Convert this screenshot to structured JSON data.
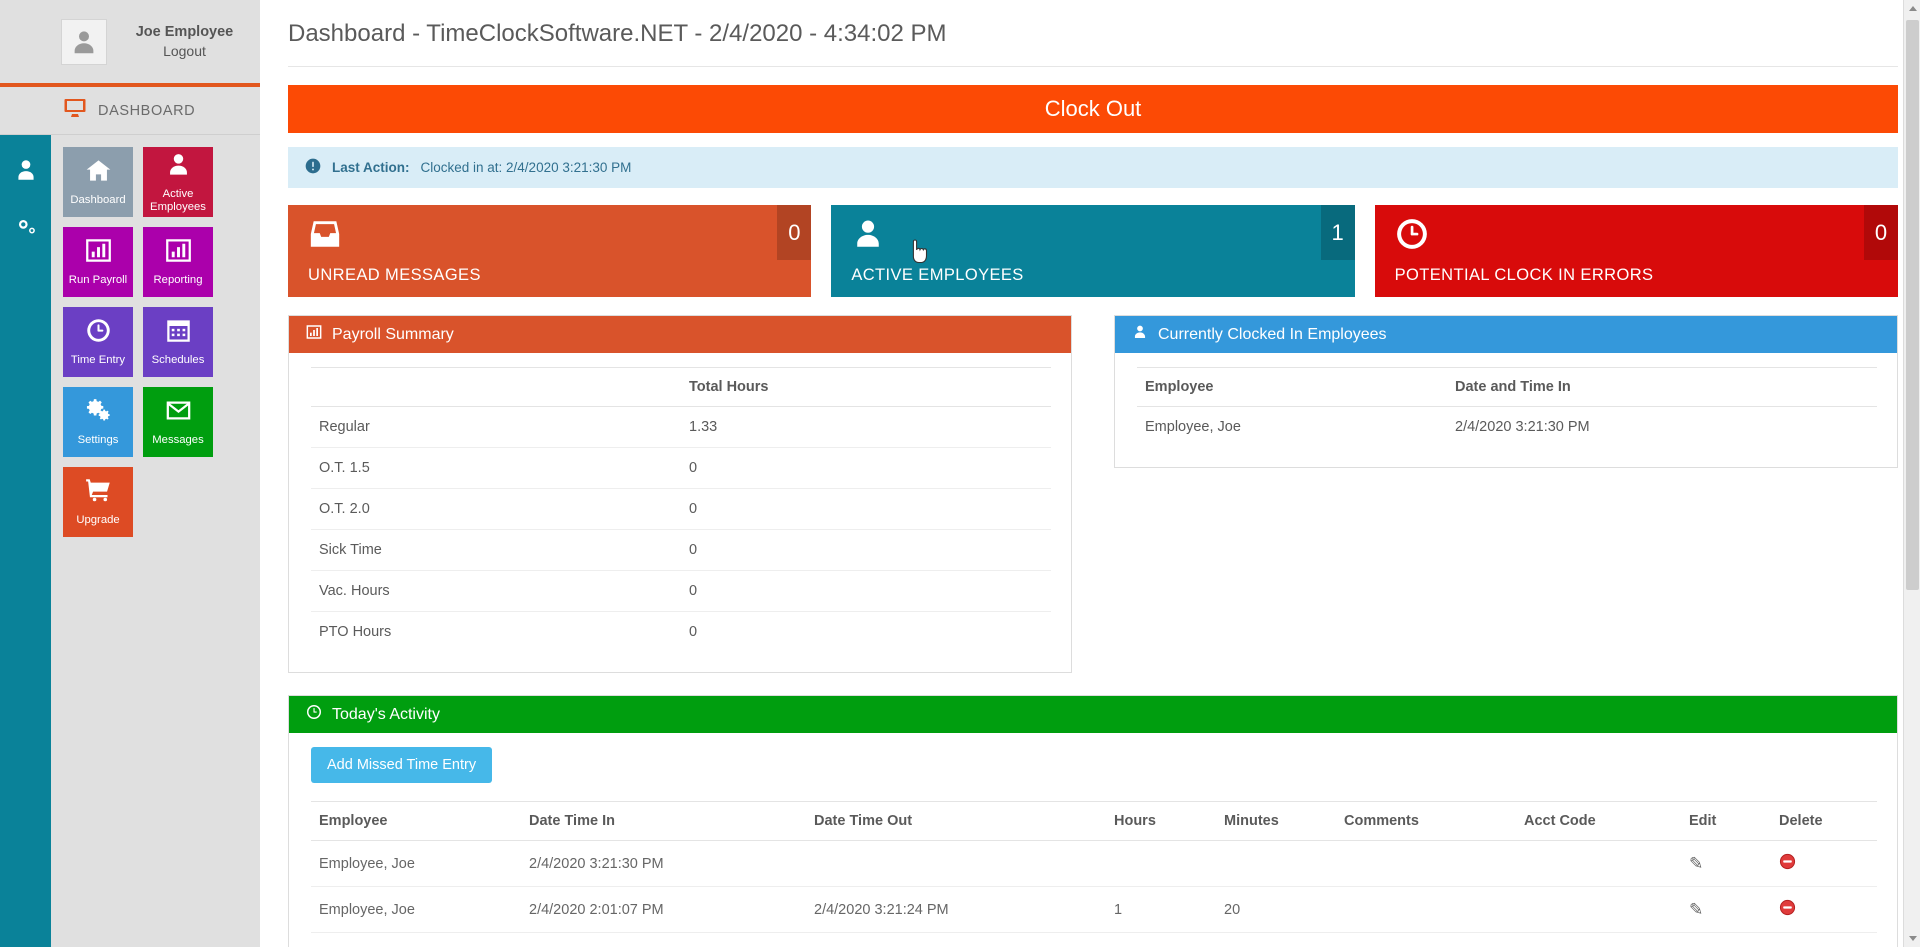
{
  "user": {
    "name": "Joe Employee",
    "logout": "Logout"
  },
  "sidebar": {
    "section_title": "DASHBOARD",
    "rail_icons": [
      "monitor-icon",
      "user-icon",
      "gears-icon"
    ],
    "tiles": [
      {
        "label": "Dashboard",
        "icon": "home-icon",
        "color": "#8c9ead"
      },
      {
        "label": "Active Employees",
        "icon": "user-icon",
        "color": "#c2163f"
      },
      {
        "label": "Run Payroll",
        "icon": "chart-bar-icon",
        "color": "#ab00ab"
      },
      {
        "label": "Reporting",
        "icon": "chart-bar-icon",
        "color": "#ab00ab"
      },
      {
        "label": "Time Entry",
        "icon": "clock-icon",
        "color": "#6b3fc4"
      },
      {
        "label": "Schedules",
        "icon": "calendar-icon",
        "color": "#6b3fc4"
      },
      {
        "label": "Settings",
        "icon": "gears-icon",
        "color": "#3498db"
      },
      {
        "label": "Messages",
        "icon": "envelope-icon",
        "color": "#009e0f"
      },
      {
        "label": "Upgrade",
        "icon": "cart-icon",
        "color": "#dd4b24"
      }
    ]
  },
  "header": {
    "title": "Dashboard - TimeClockSoftware.NET - 2/4/2020 - 4:34:02 PM"
  },
  "clock_button": {
    "label": "Clock Out",
    "color": "#fc4a05"
  },
  "alert": {
    "icon": "exclamation-circle-icon",
    "label": "Last Action:",
    "text": "Clocked in at: 2/4/2020 3:21:30 PM"
  },
  "stats": [
    {
      "label": "UNREAD MESSAGES",
      "count": "0",
      "icon": "inbox-icon",
      "color": "#d9532b"
    },
    {
      "label": "ACTIVE EMPLOYEES",
      "count": "1",
      "icon": "user-icon",
      "color": "#0a8299"
    },
    {
      "label": "POTENTIAL CLOCK IN ERRORS",
      "count": "0",
      "icon": "clock-icon",
      "color": "#d80b0b"
    }
  ],
  "payroll_summary": {
    "title": "Payroll Summary",
    "icon": "chart-bar-icon",
    "color": "#d9532b",
    "columns": [
      "",
      "Total Hours"
    ],
    "rows": [
      {
        "label": "Regular",
        "value": "1.33"
      },
      {
        "label": "O.T. 1.5",
        "value": "0"
      },
      {
        "label": "O.T. 2.0",
        "value": "0"
      },
      {
        "label": "Sick Time",
        "value": "0"
      },
      {
        "label": "Vac. Hours",
        "value": "0"
      },
      {
        "label": "PTO Hours",
        "value": "0"
      }
    ]
  },
  "clocked_in": {
    "title": "Currently Clocked In Employees",
    "icon": "user-icon",
    "color": "#3498db",
    "columns": [
      "Employee",
      "Date and Time In"
    ],
    "rows": [
      {
        "employee": "Employee, Joe",
        "datetime_in": "2/4/2020 3:21:30 PM"
      }
    ]
  },
  "activity": {
    "title": "Today's Activity",
    "icon": "clock-icon",
    "color": "#009e0f",
    "add_button": "Add Missed Time Entry",
    "columns": [
      "Employee",
      "Date Time In",
      "Date Time Out",
      "Hours",
      "Minutes",
      "Comments",
      "Acct Code",
      "Edit",
      "Delete"
    ],
    "rows": [
      {
        "employee": "Employee, Joe",
        "date_time_in": "2/4/2020 3:21:30 PM",
        "date_time_out": "",
        "hours": "",
        "minutes": "",
        "comments": "",
        "acct_code": "",
        "edit_icon": "pencil-icon",
        "delete_icon": "delete-circle-icon"
      },
      {
        "employee": "Employee, Joe",
        "date_time_in": "2/4/2020 2:01:07 PM",
        "date_time_out": "2/4/2020 3:21:24 PM",
        "hours": "1",
        "minutes": "20",
        "comments": "",
        "acct_code": "",
        "edit_icon": "pencil-icon",
        "delete_icon": "delete-circle-icon"
      }
    ]
  }
}
